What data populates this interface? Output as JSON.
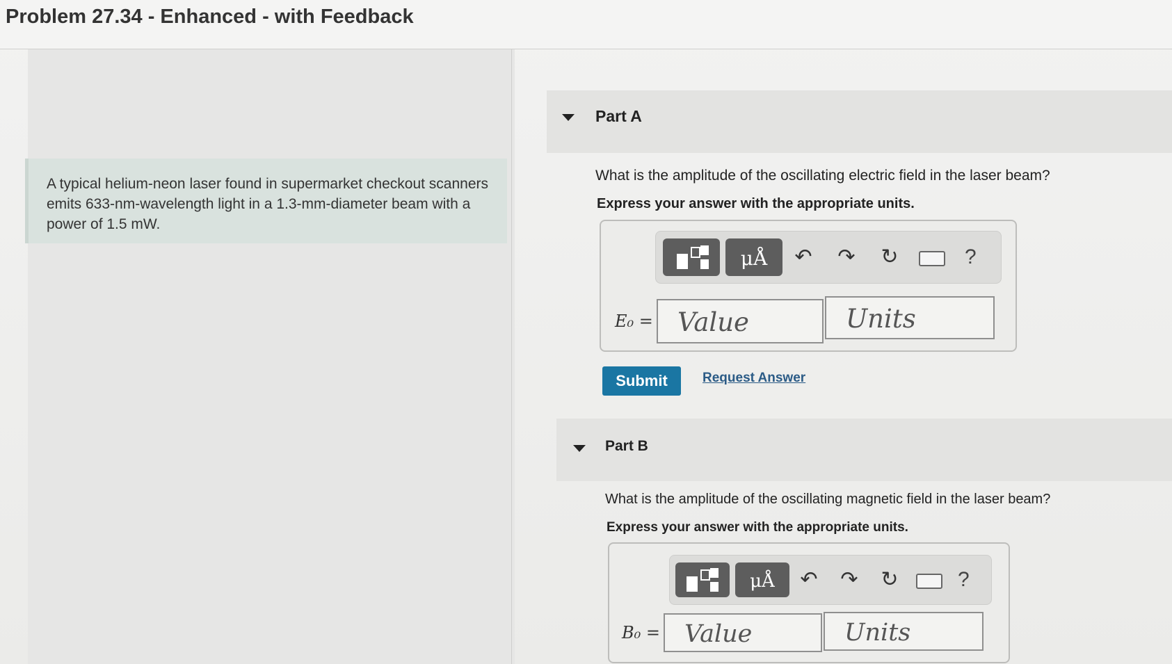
{
  "page": {
    "title": "Problem 27.34 - Enhanced - with Feedback"
  },
  "problem": {
    "text": "A typical helium-neon laser found in supermarket checkout scanners emits 633-nm-wavelength light in a 1.3-mm-diameter beam with a power of 1.5 mW."
  },
  "part_a": {
    "label": "Part A",
    "question": "What is the amplitude of the oscillating electric field in the laser beam?",
    "instruction": "Express your answer with the appropriate units.",
    "variable": "E₀ =",
    "value_placeholder": "Value",
    "units_placeholder": "Units",
    "submit_label": "Submit",
    "request_label": "Request Answer"
  },
  "part_b": {
    "label": "Part B",
    "question": "What is the amplitude of the oscillating magnetic field in the laser beam?",
    "instruction": "Express your answer with the appropriate units.",
    "variable": "B₀ =",
    "value_placeholder": "Value",
    "units_placeholder": "Units"
  },
  "toolbar": {
    "units_glyph": "μÅ",
    "undo_glyph": "↶",
    "redo_glyph": "↷",
    "reset_glyph": "↻",
    "help_glyph": "?"
  }
}
